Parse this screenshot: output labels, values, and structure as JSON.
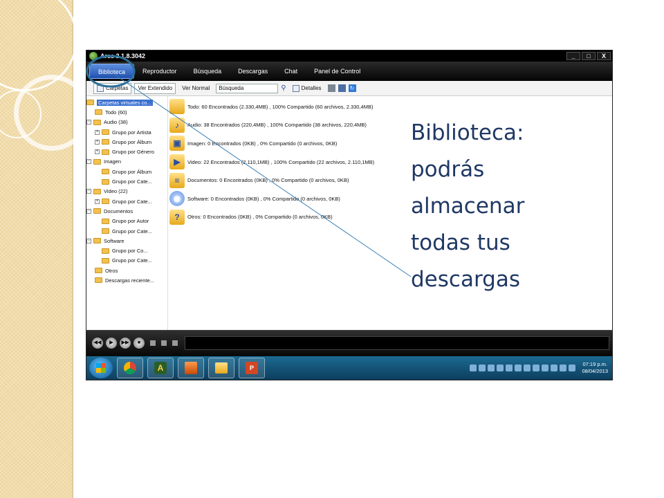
{
  "app": {
    "title": "Ares 2.1.8.3042",
    "window_buttons": [
      "_",
      "□",
      "X"
    ],
    "menu_tabs": [
      {
        "label": "Biblioteca",
        "active": true
      },
      {
        "label": "Reproductor",
        "active": false
      },
      {
        "label": "Búsqueda",
        "active": false
      },
      {
        "label": "Descargas",
        "active": false
      },
      {
        "label": "Chat",
        "active": false
      },
      {
        "label": "Panel de Control",
        "active": false
      }
    ],
    "toolbar": {
      "carpetas": "Carpetas",
      "ver_extendido": "Ver Extendido",
      "ver_normal": "Ver Normal",
      "search_value": "Búsqueda",
      "detalles": "Detalles"
    },
    "tree": [
      "Carpetas virtuales co...",
      "Todo (60)",
      "Audio (38)",
      "Grupo por Artista",
      "Grupo por Álbum",
      "Grupo por Género",
      "Imagen",
      "Grupo por Álbum",
      "Grupo por Cate...",
      "Video (22)",
      "Grupo por Cate...",
      "Documentos",
      "Grupo por Autor",
      "Grupo por Cate...",
      "Software",
      "Grupo por Co...",
      "Grupo por Cate...",
      "Otros",
      "Descargas reciente..."
    ],
    "results": [
      "Todo: 60 Encontrados (2.330,4MB) , 100% Compartido (60 archivos, 2.330,4MB)",
      "Audio: 38 Encontrados (220,4MB) , 100% Compartido (38 archivos, 220,4MB)",
      "Imagen: 0 Encontrados (0KB) , 0% Compartido (0 archivos, 0KB)",
      "Video: 22 Encontrados (2.110,1MB) , 100% Compartido (22 archivos, 2.110,1MB)",
      "Documentos: 0 Encontrados (0KB) , 0% Compartido (0 archivos, 0KB)",
      "Software: 0 Encontrados (0KB) , 0% Compartido (0 archivos, 0KB)",
      "Otros: 0 Encontrados (0KB) , 0% Compartido (0 archivos, 0KB)"
    ],
    "clock": {
      "time": "07:19 p.m.",
      "date": "08/04/2013"
    }
  },
  "caption_lines": [
    "Biblioteca:",
    "podrás",
    "almacenar",
    "todas tus",
    "descargas"
  ],
  "colors": {
    "caption": "#1f3864",
    "callout": "#3a7fb5",
    "menu_active": "#3a6fd0"
  }
}
